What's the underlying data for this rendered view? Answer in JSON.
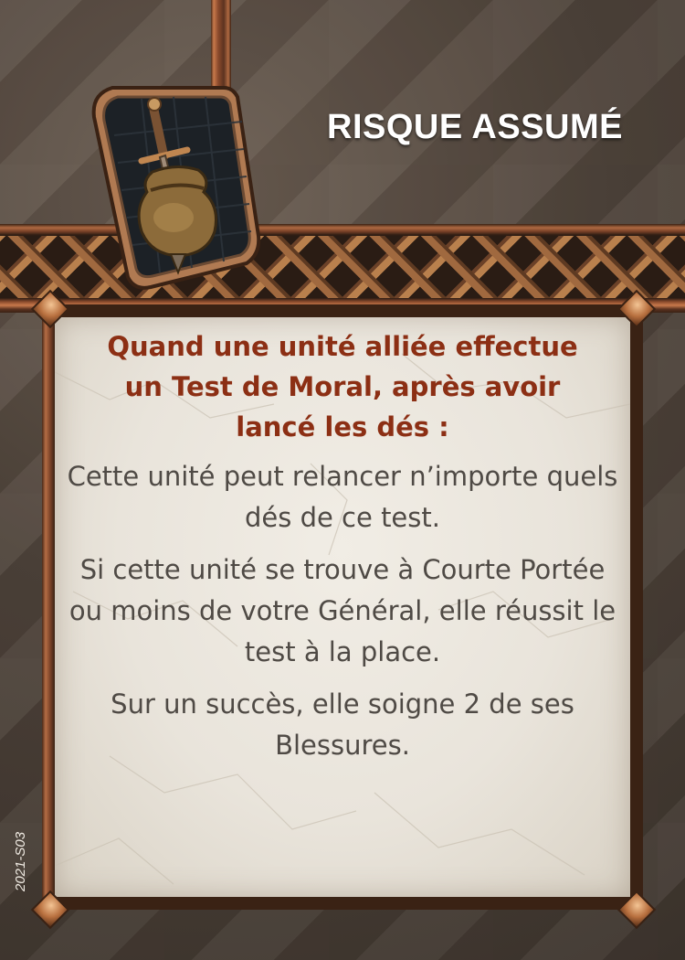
{
  "card": {
    "title": "RISQUE ASSUMÉ",
    "trigger": "Quand une unité alliée effectue un Test de Moral, après avoir lancé les dés :",
    "effects": [
      "Cette unité peut relancer n’importe quels dés de ce test.",
      "Si cette unité se trouve à Courte Portée ou moins de votre Général, elle réussit le test à la place.",
      "Sur un succès, elle soigne 2 de ses Blessures."
    ],
    "code": "2021-S03",
    "icon": "sword-and-pouch-icon"
  },
  "colors": {
    "trigger_text": "#8c2f14",
    "body_text": "#4f4a45",
    "title_text": "#ffffff",
    "frame_copper": "#b56d45",
    "parchment": "#ebe6dd"
  }
}
